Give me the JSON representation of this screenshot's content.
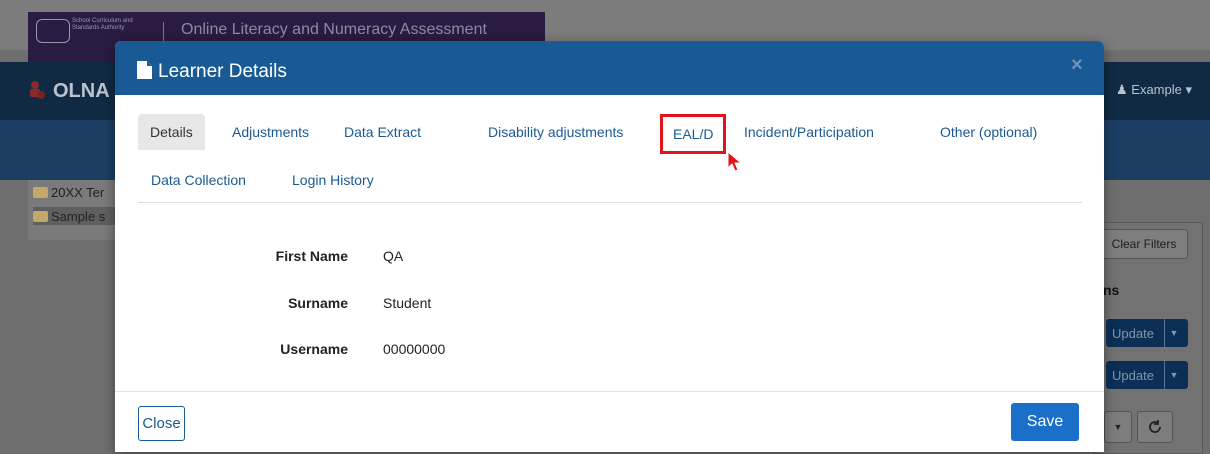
{
  "background": {
    "org_name": "School Curriculum and Standards Authority",
    "app_title": "Online Literacy and Numeracy Assessment",
    "navbar_title": "OLNA",
    "user_menu": "Example",
    "tree_items": [
      "20XX Ter",
      "Sample s"
    ],
    "clear_filters": "Clear Filters",
    "column_fragment": "ns",
    "update_label": "Update"
  },
  "modal": {
    "title": "Learner Details",
    "close_glyph": "×",
    "tabs": [
      {
        "label": "Details",
        "active": true
      },
      {
        "label": "Adjustments"
      },
      {
        "label": "Data Extract"
      },
      {
        "label": "Disability adjustments"
      },
      {
        "label": "EAL/D",
        "highlighted": true
      },
      {
        "label": "Incident/Participation"
      },
      {
        "label": "Other (optional)"
      },
      {
        "label": "Data Collection"
      },
      {
        "label": "Login History"
      }
    ],
    "fields": {
      "first_name": {
        "label": "First Name",
        "value": "QA"
      },
      "surname": {
        "label": "Surname",
        "value": "Student"
      },
      "username": {
        "label": "Username",
        "value": "00000000"
      }
    },
    "footer": {
      "close_label": "Close",
      "save_label": "Save"
    }
  },
  "colors": {
    "header_blue": "#1a5a94",
    "save_blue": "#1a6fc9",
    "highlight_red": "#e3131c"
  },
  "icons": [
    "document-icon",
    "cursor-arrow-icon",
    "folder-icon",
    "user-icon",
    "refresh-icon",
    "caret-down-icon"
  ]
}
